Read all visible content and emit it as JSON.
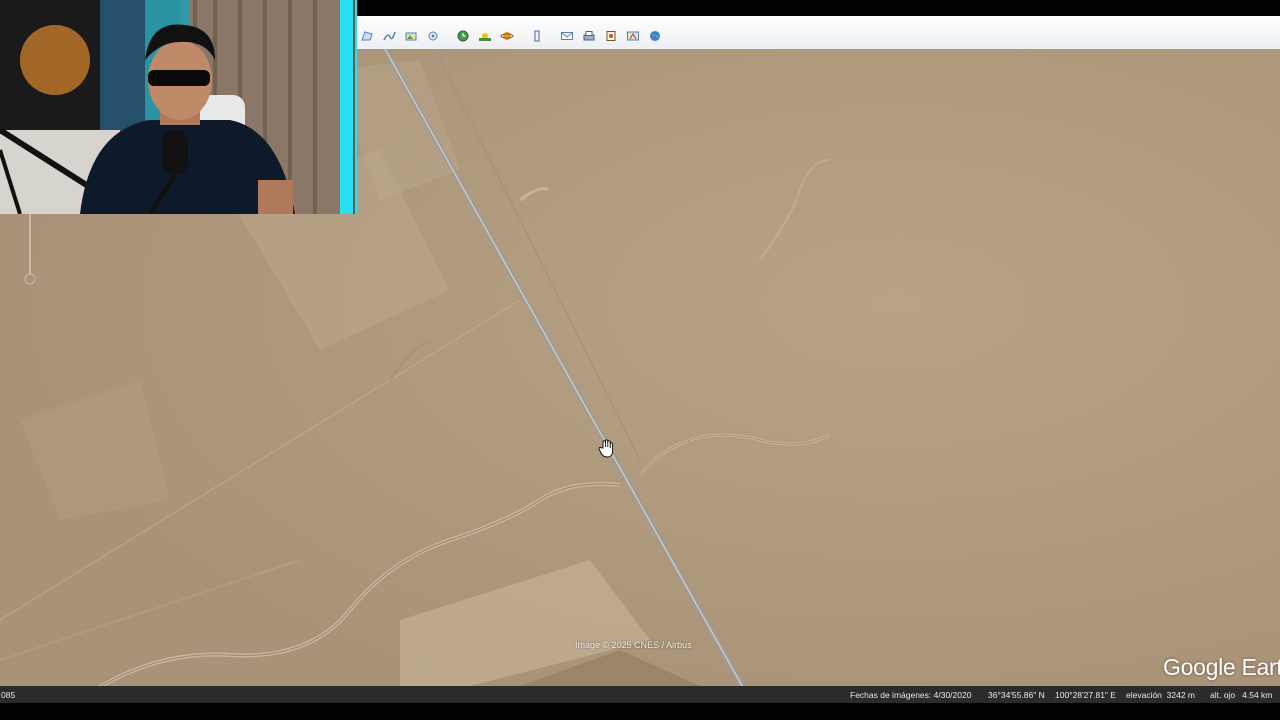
{
  "toolbar": {
    "buttons": [
      {
        "name": "add-polygon-button",
        "icon": "polygon-icon"
      },
      {
        "name": "add-path-button",
        "icon": "path-icon"
      },
      {
        "name": "add-image-overlay-button",
        "icon": "image-overlay-icon"
      },
      {
        "name": "record-tour-button",
        "icon": "tour-icon"
      },
      {
        "name": "historical-imagery-button",
        "icon": "clock-icon"
      },
      {
        "name": "sunlight-button",
        "icon": "sun-icon"
      },
      {
        "name": "switch-planet-button",
        "icon": "planet-icon"
      },
      {
        "name": "ruler-button",
        "icon": "ruler-icon"
      },
      {
        "name": "email-button",
        "icon": "email-icon"
      },
      {
        "name": "print-button",
        "icon": "print-icon"
      },
      {
        "name": "save-image-button",
        "icon": "save-image-icon"
      },
      {
        "name": "view-in-maps-button",
        "icon": "maps-icon"
      },
      {
        "name": "web-button",
        "icon": "globe-icon"
      }
    ]
  },
  "map": {
    "attribution": "Image © 2025 CNES / Airbus",
    "logo": "Google Eart"
  },
  "status": {
    "left_fragment": "085",
    "imagery_date": "Fechas de imágenes: 4/30/2020",
    "latitude": "36°34'55.86\" N",
    "longitude": "100°28'27.81\" E",
    "elevation": "elevación  3242 m",
    "eye_alt": "alt. ojo   4.54 km"
  },
  "colors": {
    "terrain": "#b29d80",
    "road": "#9b9c98",
    "webcam_border": "#27e0f0"
  }
}
